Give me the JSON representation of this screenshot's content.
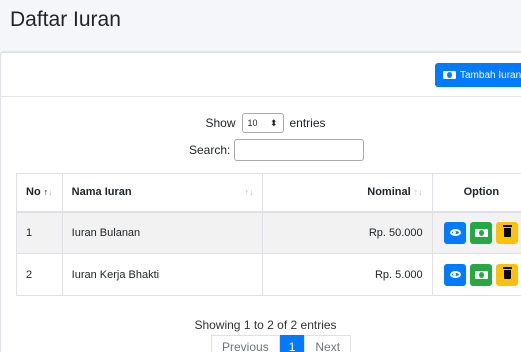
{
  "page": {
    "title": "Daftar Iuran"
  },
  "toolbar": {
    "add_label": "Tambah Iuran"
  },
  "length": {
    "prefix": "Show",
    "value": "10",
    "suffix": "entries"
  },
  "search": {
    "label": "Search:",
    "value": ""
  },
  "table": {
    "headers": [
      "No",
      "Nama Iuran",
      "Nominal",
      "Option"
    ],
    "rows": [
      {
        "no": "1",
        "nama": "Iuran Bulanan",
        "nominal": "Rp. 50.000"
      },
      {
        "no": "2",
        "nama": "Iuran Kerja Bhakti",
        "nominal": "Rp. 5.000"
      }
    ]
  },
  "footer": {
    "info": "Showing 1 to 2 of 2 entries",
    "previous": "Previous",
    "current_page": "1",
    "next": "Next"
  },
  "colors": {
    "primary": "#007bff",
    "success": "#28a745",
    "warning": "#ffc107"
  },
  "icons": [
    "money-icon",
    "eye-icon",
    "trash-icon",
    "sort-icon",
    "caret-icon"
  ]
}
